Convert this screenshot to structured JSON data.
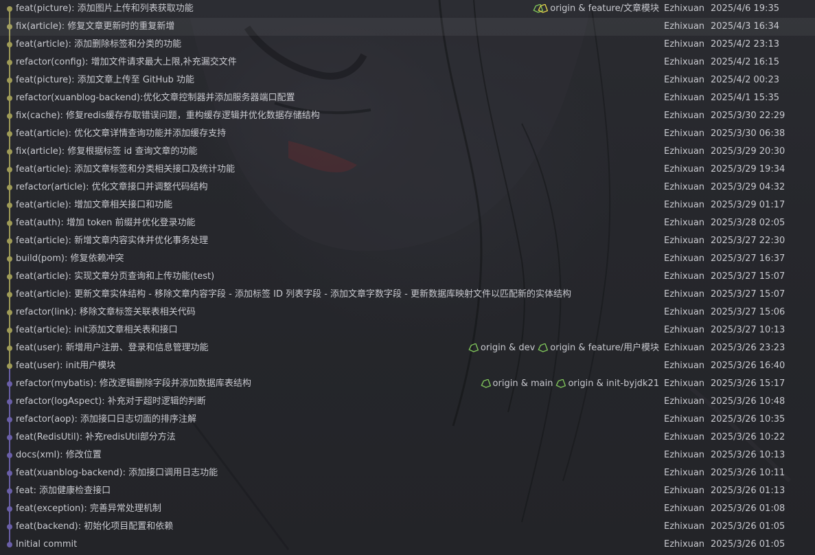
{
  "commits": [
    {
      "message": "feat(picture): 添加图片上传和列表获取功能",
      "refs": [
        {
          "label": "origin & feature/文章模块",
          "icon": "tag-pair-icon"
        }
      ],
      "author": "Ezhixuan",
      "date": "2025/4/6 19:35",
      "branch": "feature",
      "selected": false
    },
    {
      "message": "fix(article): 修复文章更新时的重复新增",
      "refs": [],
      "author": "Ezhixuan",
      "date": "2025/4/3 16:34",
      "branch": "feature",
      "selected": true
    },
    {
      "message": "feat(article): 添加删除标签和分类的功能",
      "refs": [],
      "author": "Ezhixuan",
      "date": "2025/4/2 23:13",
      "branch": "feature",
      "selected": false
    },
    {
      "message": "refactor(config): 增加文件请求最大上限,补充漏交文件",
      "refs": [],
      "author": "Ezhixuan",
      "date": "2025/4/2 16:15",
      "branch": "feature",
      "selected": false
    },
    {
      "message": "feat(picture): 添加文章上传至 GitHub 功能",
      "refs": [],
      "author": "Ezhixuan",
      "date": "2025/4/2 00:23",
      "branch": "feature",
      "selected": false
    },
    {
      "message": "refactor(xuanblog-backend):优化文章控制器并添加服务器端口配置",
      "refs": [],
      "author": "Ezhixuan",
      "date": "2025/4/1 15:35",
      "branch": "feature",
      "selected": false
    },
    {
      "message": "fix(cache): 修复redis缓存存取错误问题，重构缓存逻辑并优化数据存储结构",
      "refs": [],
      "author": "Ezhixuan",
      "date": "2025/3/30 22:29",
      "branch": "feature",
      "selected": false
    },
    {
      "message": "feat(article): 优化文章详情查询功能并添加缓存支持",
      "refs": [],
      "author": "Ezhixuan",
      "date": "2025/3/30 06:38",
      "branch": "feature",
      "selected": false
    },
    {
      "message": "fix(article): 修复根据标签 id 查询文章的功能",
      "refs": [],
      "author": "Ezhixuan",
      "date": "2025/3/29 20:30",
      "branch": "feature",
      "selected": false
    },
    {
      "message": "feat(article): 添加文章标签和分类相关接口及统计功能",
      "refs": [],
      "author": "Ezhixuan",
      "date": "2025/3/29 19:34",
      "branch": "feature",
      "selected": false
    },
    {
      "message": "refactor(article): 优化文章接口并调整代码结构",
      "refs": [],
      "author": "Ezhixuan",
      "date": "2025/3/29 04:32",
      "branch": "feature",
      "selected": false
    },
    {
      "message": "feat(article): 增加文章相关接口和功能",
      "refs": [],
      "author": "Ezhixuan",
      "date": "2025/3/29 01:17",
      "branch": "feature",
      "selected": false
    },
    {
      "message": "feat(auth): 增加 token 前缀并优化登录功能",
      "refs": [],
      "author": "Ezhixuan",
      "date": "2025/3/28 02:05",
      "branch": "feature",
      "selected": false
    },
    {
      "message": "feat(article): 新增文章内容实体并优化事务处理",
      "refs": [],
      "author": "Ezhixuan",
      "date": "2025/3/27 22:30",
      "branch": "feature",
      "selected": false
    },
    {
      "message": "build(pom): 修复依赖冲突",
      "refs": [],
      "author": "Ezhixuan",
      "date": "2025/3/27 16:37",
      "branch": "feature",
      "selected": false
    },
    {
      "message": "feat(article): 实现文章分页查询和上传功能(test)",
      "refs": [],
      "author": "Ezhixuan",
      "date": "2025/3/27 15:07",
      "branch": "feature",
      "selected": false
    },
    {
      "message": "feat(article): 更新文章实体结构 - 移除文章内容字段 - 添加标签 ID 列表字段 - 添加文章字数字段 - 更新数据库映射文件以匹配新的实体结构",
      "refs": [],
      "author": "Ezhixuan",
      "date": "2025/3/27 15:07",
      "branch": "feature",
      "selected": false
    },
    {
      "message": "refactor(link): 移除文章标签关联表相关代码",
      "refs": [],
      "author": "Ezhixuan",
      "date": "2025/3/27 15:06",
      "branch": "feature",
      "selected": false
    },
    {
      "message": "feat(article): init添加文章相关表和接口",
      "refs": [],
      "author": "Ezhixuan",
      "date": "2025/3/27 10:13",
      "branch": "feature",
      "selected": false
    },
    {
      "message": "feat(user): 新增用户注册、登录和信息管理功能",
      "refs": [
        {
          "label": "origin & dev",
          "icon": "tag-icon"
        },
        {
          "label": "origin & feature/用户模块",
          "icon": "tag-icon"
        }
      ],
      "author": "Ezhixuan",
      "date": "2025/3/26 23:23",
      "branch": "feature",
      "selected": false
    },
    {
      "message": "feat(user): init用户模块",
      "refs": [],
      "author": "Ezhixuan",
      "date": "2025/3/26 16:40",
      "branch": "feature",
      "selected": false
    },
    {
      "message": "refactor(mybatis): 修改逻辑删除字段并添加数据库表结构",
      "refs": [
        {
          "label": "origin & main",
          "icon": "tag-icon"
        },
        {
          "label": "origin & init-byjdk21",
          "icon": "tag-icon"
        }
      ],
      "author": "Ezhixuan",
      "date": "2025/3/26 15:17",
      "branch": "main",
      "selected": false
    },
    {
      "message": "refactor(logAspect): 补充对于超时逻辑的判断",
      "refs": [],
      "author": "Ezhixuan",
      "date": "2025/3/26 10:48",
      "branch": "main",
      "selected": false
    },
    {
      "message": "refactor(aop): 添加接口日志切面的排序注解",
      "refs": [],
      "author": "Ezhixuan",
      "date": "2025/3/26 10:35",
      "branch": "main",
      "selected": false
    },
    {
      "message": "feat(RedisUtil): 补充redisUtil部分方法",
      "refs": [],
      "author": "Ezhixuan",
      "date": "2025/3/26 10:22",
      "branch": "main",
      "selected": false
    },
    {
      "message": "docs(xml): 修改位置",
      "refs": [],
      "author": "Ezhixuan",
      "date": "2025/3/26 10:13",
      "branch": "main",
      "selected": false
    },
    {
      "message": "feat(xuanblog-backend): 添加接口调用日志功能",
      "refs": [],
      "author": "Ezhixuan",
      "date": "2025/3/26 10:11",
      "branch": "main",
      "selected": false
    },
    {
      "message": "feat: 添加健康检查接口",
      "refs": [],
      "author": "Ezhixuan",
      "date": "2025/3/26 01:13",
      "branch": "main",
      "selected": false
    },
    {
      "message": "feat(exception): 完善异常处理机制",
      "refs": [],
      "author": "Ezhixuan",
      "date": "2025/3/26 01:08",
      "branch": "main",
      "selected": false
    },
    {
      "message": "feat(backend): 初始化项目配置和依赖",
      "refs": [],
      "author": "Ezhixuan",
      "date": "2025/3/26 01:05",
      "branch": "main",
      "selected": false
    },
    {
      "message": "Initial commit",
      "refs": [],
      "author": "Ezhixuan",
      "date": "2025/3/26 01:05",
      "branch": "main",
      "selected": false
    }
  ],
  "colors": {
    "feature_branch": "#9f9b57",
    "main_branch": "#6a5fa8",
    "ref_tag_primary": "#7fc45a",
    "ref_tag_secondary": "#e0d04a",
    "text": "#c9cad0",
    "selected_row": "rgba(255,255,255,0.055)",
    "background": "#25262b"
  }
}
